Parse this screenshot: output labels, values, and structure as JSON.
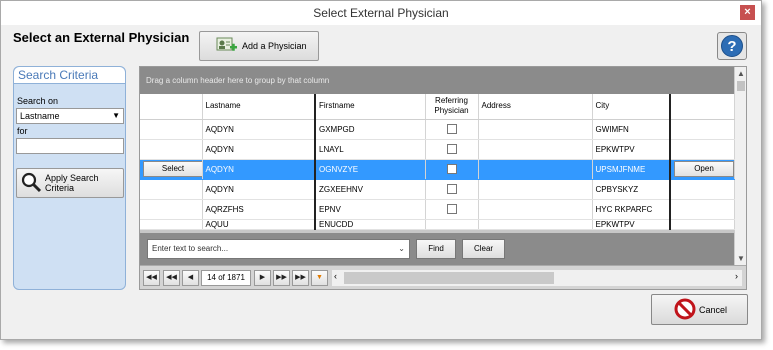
{
  "window": {
    "title": "Select External Physician",
    "close_glyph": "×"
  },
  "header": {
    "heading": "Select an External Physician",
    "add_button_label": "Add a Physician",
    "help_glyph": "?"
  },
  "search_criteria": {
    "title": "Search Criteria",
    "search_on_label": "Search on",
    "search_on_value": "Lastname",
    "for_label": "for",
    "for_value": "",
    "apply_label": "Apply Search Criteria"
  },
  "grid": {
    "group_panel_text": "Drag a column header here to group by that column",
    "columns": [
      "",
      "Lastname",
      "Firstname",
      "Referring Physician",
      "Address",
      "City",
      ""
    ],
    "select_button_label": "Select",
    "open_button_label": "Open",
    "rows": [
      {
        "lastname": "AQDYN",
        "firstname": "GXMPGD",
        "city": "GWIMFN",
        "selected": false
      },
      {
        "lastname": "AQDYN",
        "firstname": "LNAYL",
        "city": "EPKWTPV",
        "selected": false
      },
      {
        "lastname": "AQDYN",
        "firstname": "OGNVZYE",
        "city": "UPSMJFNME",
        "selected": true
      },
      {
        "lastname": "AQDYN",
        "firstname": "ZGXEEHNV",
        "city": "CPBYSKYZ",
        "selected": false
      },
      {
        "lastname": "AQRZFHS",
        "firstname": "EPNV",
        "city": "HYC RKPARFC",
        "selected": false
      },
      {
        "lastname": "AQUU",
        "firstname": "ENUCDD",
        "city": "EPKWTPV",
        "selected": false
      }
    ]
  },
  "search_bar": {
    "placeholder": "Enter text to search...",
    "find_label": "Find",
    "clear_label": "Clear"
  },
  "pager": {
    "info": "14 of 1871"
  },
  "footer": {
    "cancel_label": "Cancel"
  },
  "colors": {
    "selected_row": "#3399ff",
    "panel_blue": "#cfe0f3",
    "grid_header_gray": "#8b8b8b"
  }
}
